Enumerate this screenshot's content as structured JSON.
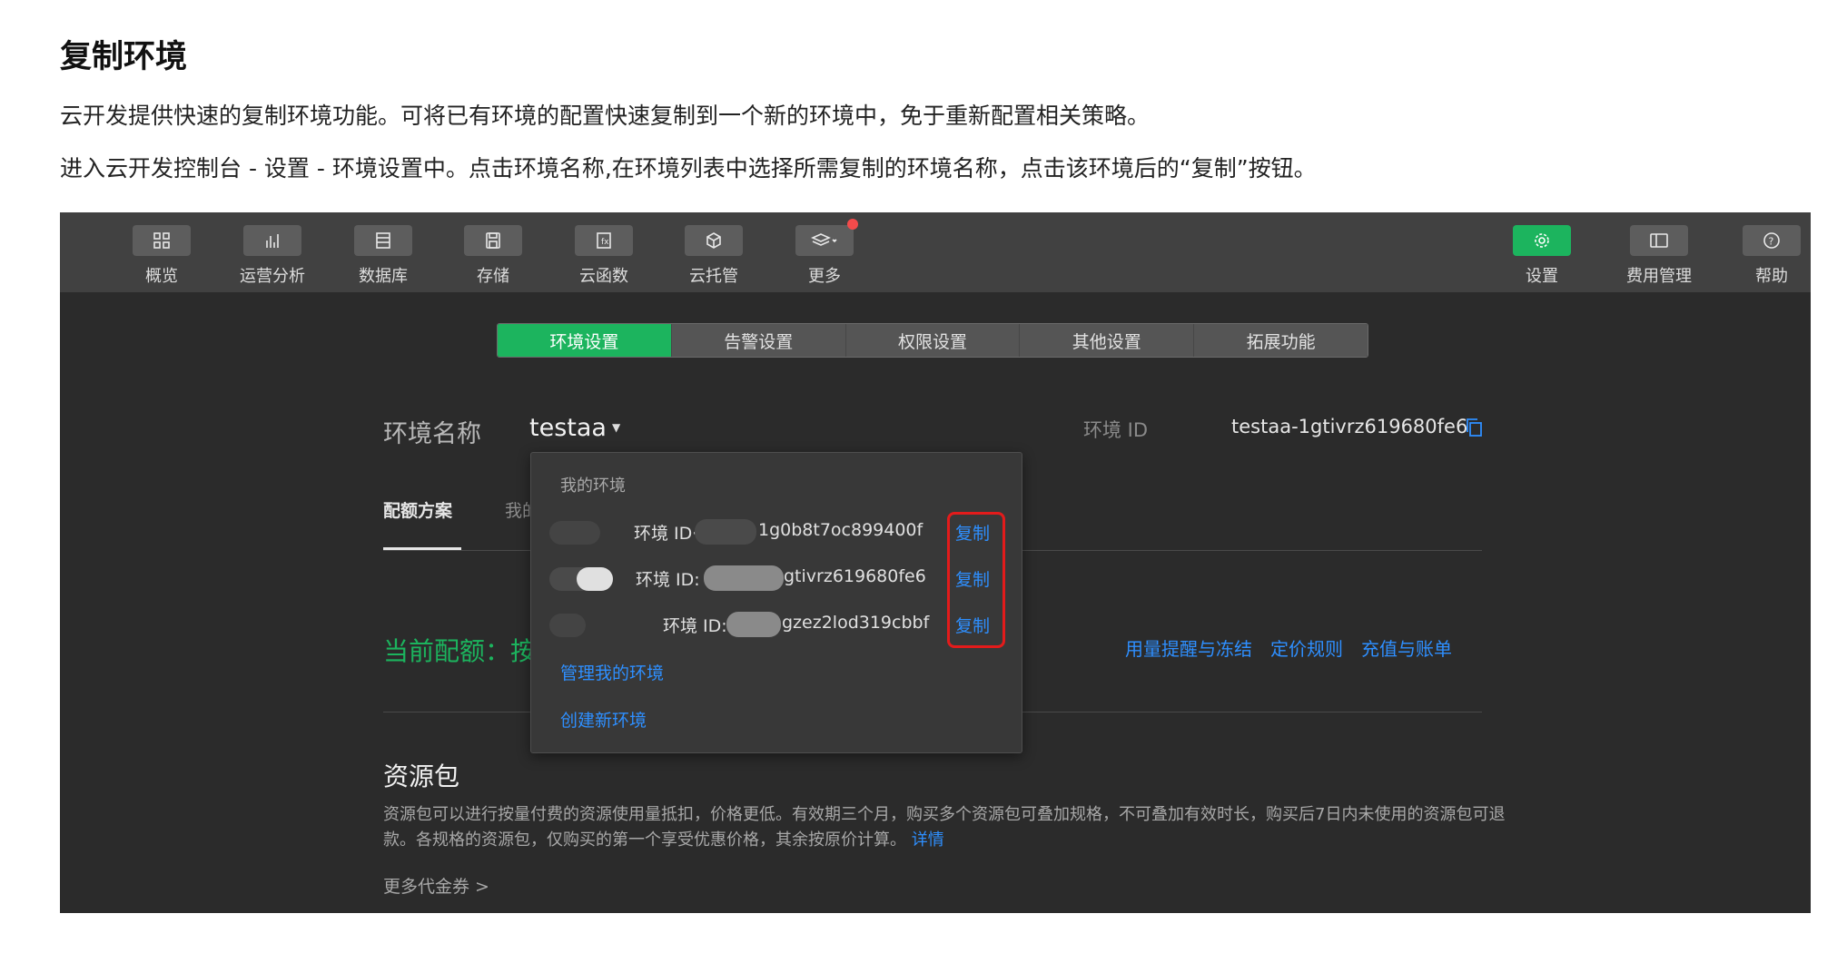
{
  "doc": {
    "title": "复制环境",
    "p1": "云开发提供快速的复制环境功能。可将已有环境的配置快速复制到一个新的环境中，免于重新配置相关策略。",
    "p2": "进入云开发控制台 - 设置 - 环境设置中。点击环境名称,在环境列表中选择所需复制的环境名称，点击该环境后的“复制”按钮。"
  },
  "nav": {
    "left": [
      {
        "label": "概览",
        "icon": "grid-icon"
      },
      {
        "label": "运营分析",
        "icon": "bar-chart-icon"
      },
      {
        "label": "数据库",
        "icon": "database-icon"
      },
      {
        "label": "存储",
        "icon": "save-icon"
      },
      {
        "label": "云函数",
        "icon": "function-icon"
      },
      {
        "label": "云托管",
        "icon": "cube-icon"
      },
      {
        "label": "更多",
        "icon": "layers-icon"
      }
    ],
    "right": [
      {
        "label": "设置",
        "icon": "gear-icon"
      },
      {
        "label": "费用管理",
        "icon": "wallet-icon"
      },
      {
        "label": "帮助",
        "icon": "help-icon"
      }
    ]
  },
  "tabs": [
    "环境设置",
    "告警设置",
    "权限设置",
    "其他设置",
    "拓展功能"
  ],
  "env": {
    "name_label": "环境名称",
    "name": "testaa",
    "id_label": "环境 ID",
    "id": "testaa-1gtivrz619680fe6"
  },
  "subtabs": {
    "active": "配额方案",
    "next": "我的"
  },
  "quota": {
    "text": "当前配额：按"
  },
  "links": [
    "用量提醒与冻结",
    "定价规则",
    "充值与账单"
  ],
  "resource": {
    "title": "资源包",
    "desc": "资源包可以进行按量付费的资源使用量抵扣，价格更低。有效期三个月，购买多个资源包可叠加规格，不可叠加有效时长，购买后7日内未使用的资源包可退款。各规格的资源包，仅购买的第一个享受优惠价格，其余按原价计算。",
    "more": "详情",
    "coupon": "更多代金券 >"
  },
  "dropdown": {
    "title": "我的环境",
    "rows": [
      {
        "id_label": "环境 ID·",
        "id_suffix": "1g0b8t7oc899400f",
        "copy": "复制"
      },
      {
        "id_label": "环境 ID:",
        "id_suffix": "gtivrz619680fe6",
        "copy": "复制"
      },
      {
        "id_label": "环境 ID:",
        "id_suffix": "gzez2lod319cbbf",
        "copy": "复制"
      }
    ],
    "manage": "管理我的环境",
    "create": "创建新环境"
  },
  "colors": {
    "accent": "#1cb45e",
    "link": "#2e8fff",
    "highlight": "#e31b1b"
  }
}
